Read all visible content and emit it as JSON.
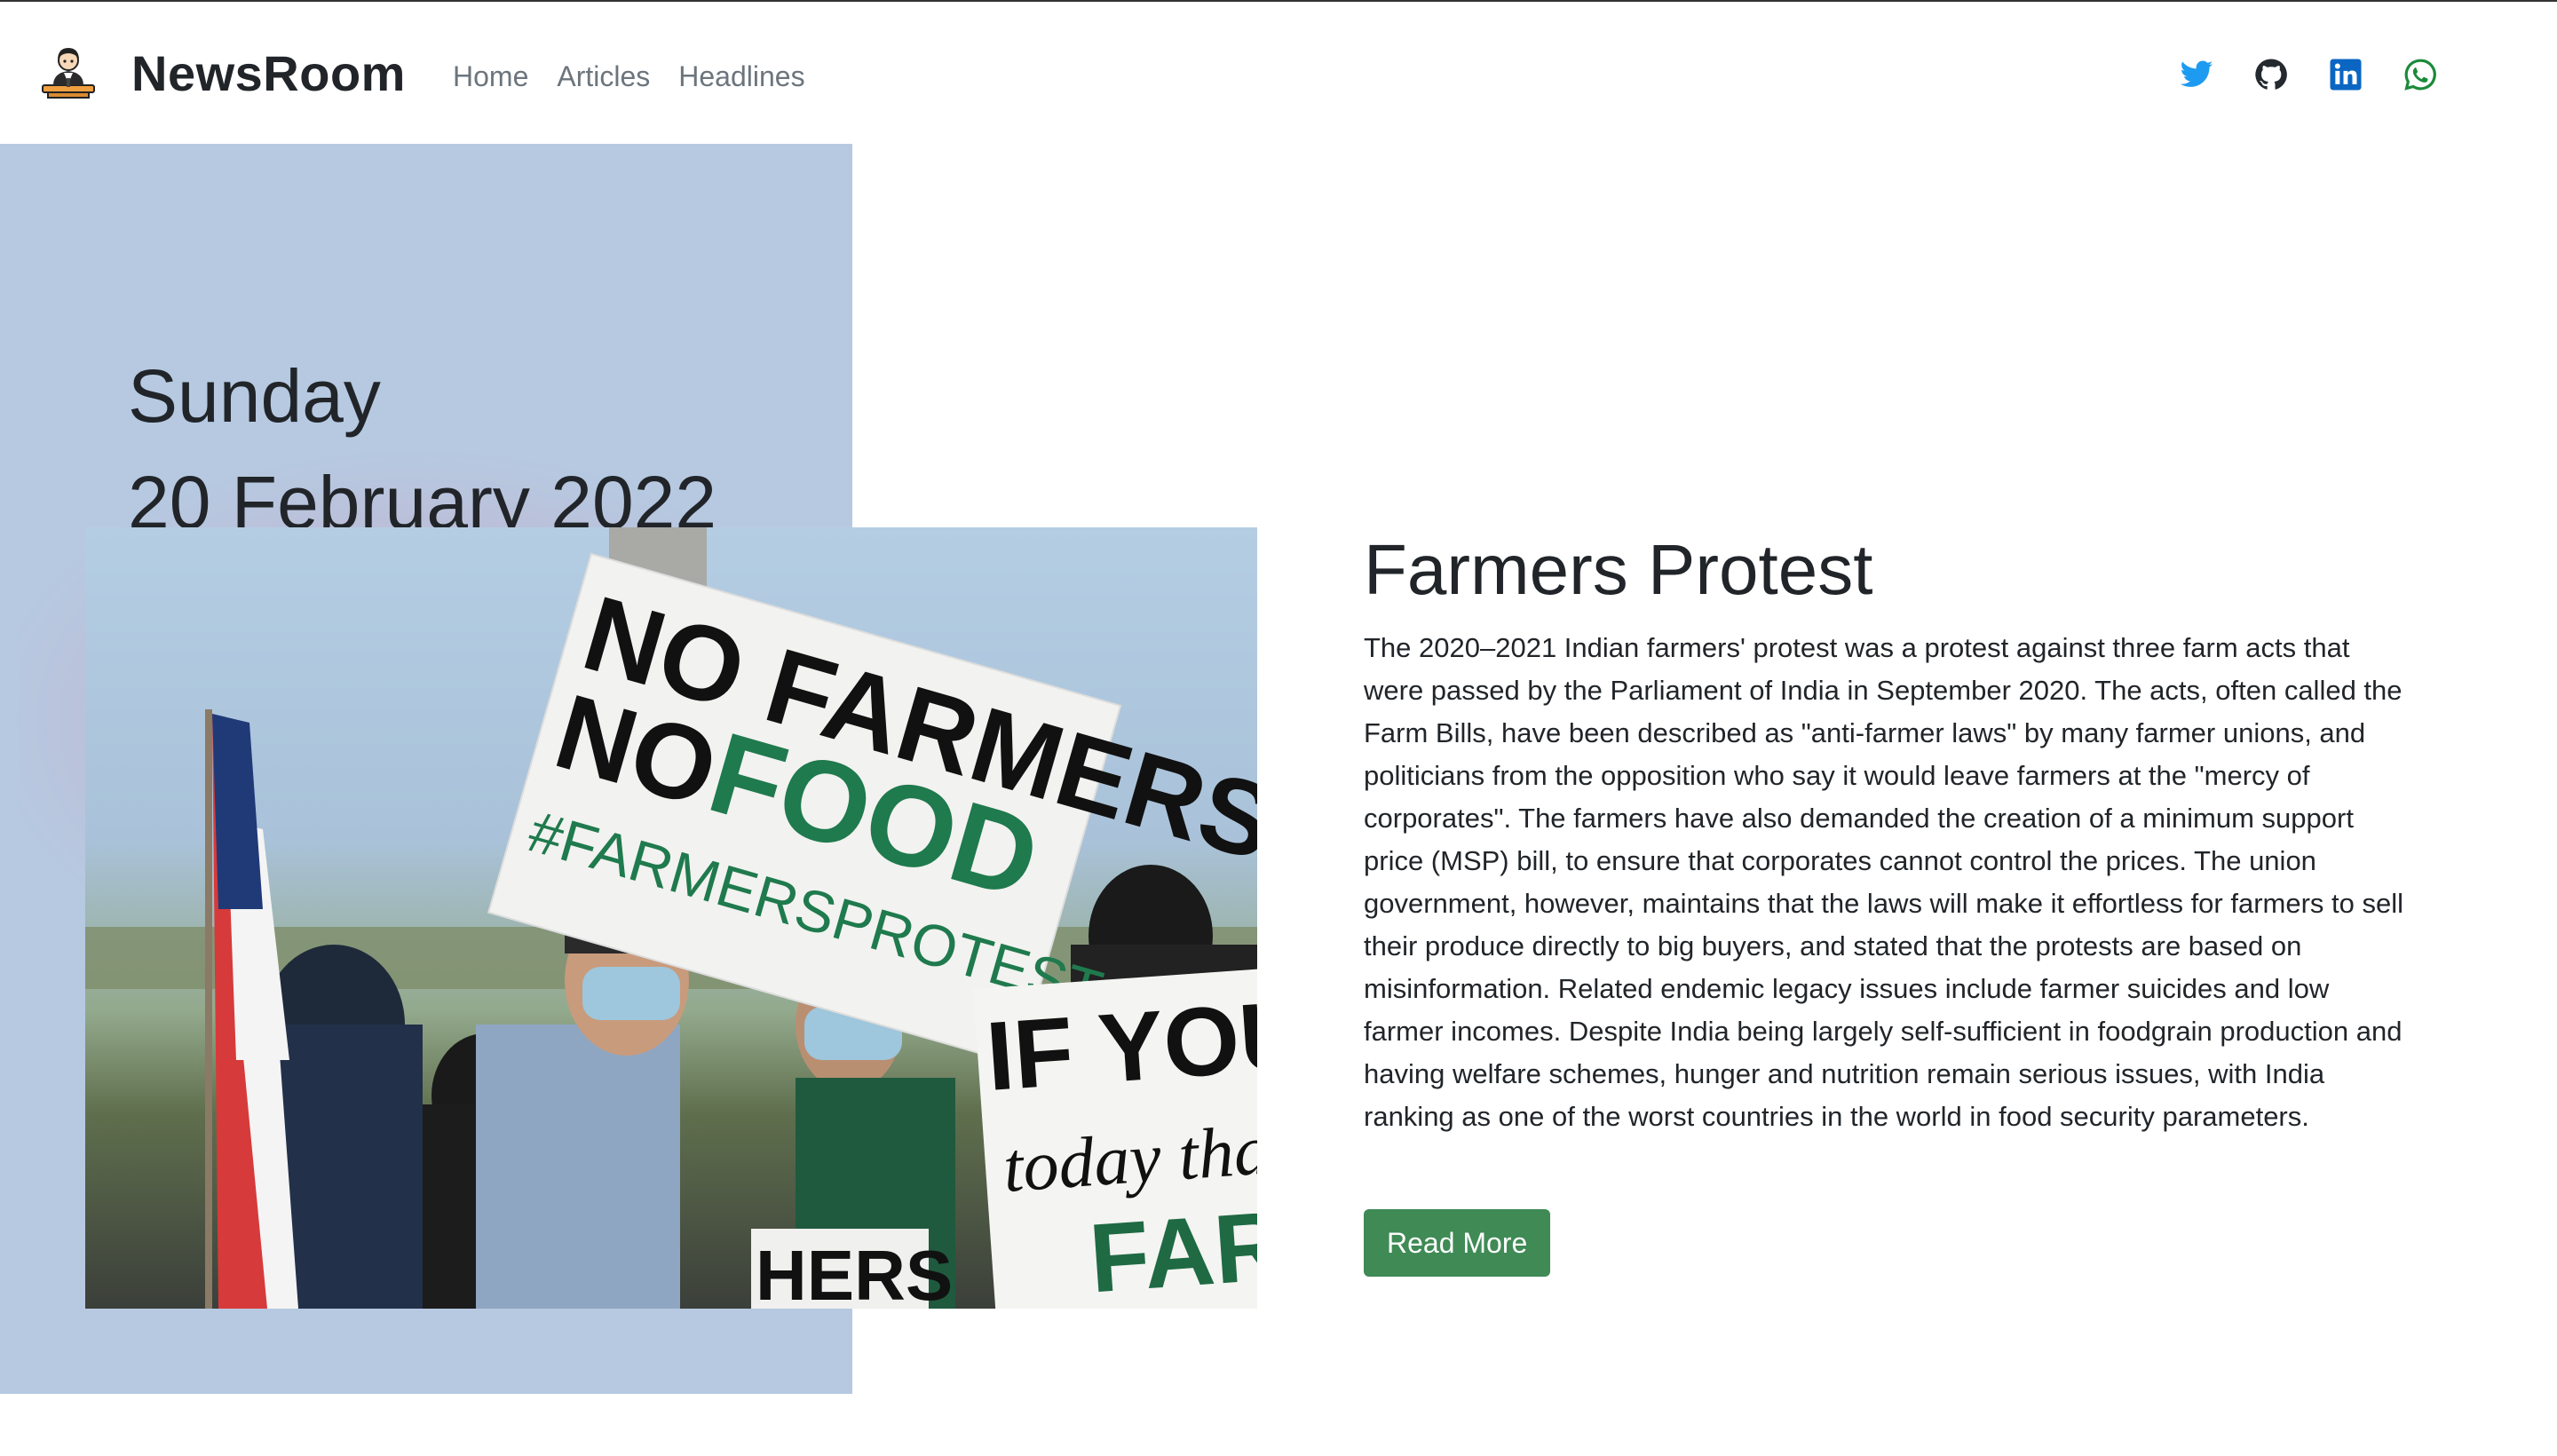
{
  "brand": {
    "name": "NewsRoom",
    "logo_icon": "reporter-icon"
  },
  "nav": {
    "links": [
      {
        "label": "Home"
      },
      {
        "label": "Articles"
      },
      {
        "label": "Headlines"
      }
    ]
  },
  "social": [
    {
      "icon": "twitter-icon",
      "color": "#1d9bf0"
    },
    {
      "icon": "github-icon",
      "color": "#24292f"
    },
    {
      "icon": "linkedin-icon",
      "color": "#0a66c2"
    },
    {
      "icon": "whatsapp-icon",
      "color": "#1b8a3a"
    }
  ],
  "date": {
    "day": "Sunday",
    "full": "20 February 2022"
  },
  "article": {
    "title": "Farmers Protest",
    "body": "The 2020–2021 Indian farmers' protest was a protest against three farm acts that were passed by the Parliament of India in September 2020. The acts, often called the Farm Bills, have been described as \"anti-farmer laws\" by many farmer unions, and politicians from the opposition who say it would leave farmers at the \"mercy of corporates\". The farmers have also demanded the creation of a minimum support price (MSP) bill, to ensure that corporates cannot control the prices. The union government, however, maintains that the laws will make it effortless for farmers to sell their produce directly to big buyers, and stated that the protests are based on misinformation. Related endemic legacy issues include farmer suicides and low farmer incomes. Despite India being largely self-sufficient in foodgrain production and having welfare schemes, hunger and nutrition remain serious issues, with India ranking as one of the worst countries in the world in food security parameters.",
    "read_more": "Read More",
    "image": {
      "sign_main_line1": "NO FARMERS",
      "sign_main_line2a": "NO",
      "sign_main_line2b": "FOOD",
      "sign_main_line3": "#FARMERSPROTEST",
      "sign_right_line1": "IF YOU",
      "sign_right_line2": "today than",
      "sign_right_line3": "FAR",
      "sign_bottom": "HERS"
    }
  },
  "colors": {
    "panel": "#b6c9e1",
    "button": "#3f8a55",
    "nav_link": "#6c757d",
    "text": "#212529"
  }
}
